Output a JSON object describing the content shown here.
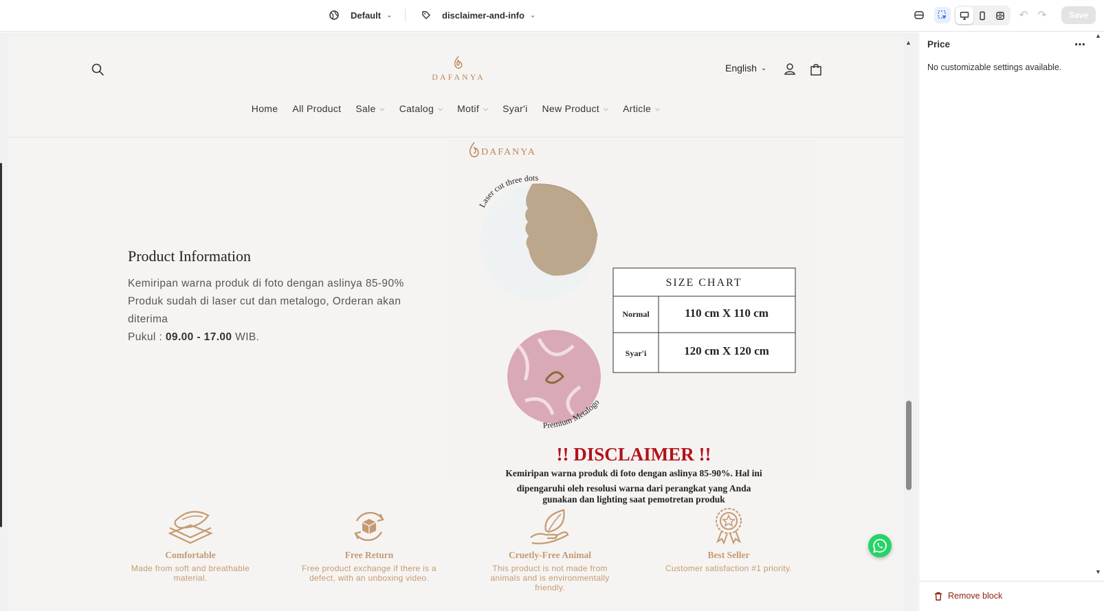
{
  "topbar": {
    "theme_label": "Default",
    "template_label": "disclaimer-and-info",
    "save_label": "Save"
  },
  "store": {
    "logo_text": "DAFANYA",
    "language": "English",
    "nav": [
      "Home",
      "All Product",
      "Sale",
      "Catalog",
      "Motif",
      "Syar'i",
      "New Product",
      "Article"
    ]
  },
  "info": {
    "heading": "Product Information",
    "line1": "Kemiripan warna produk di foto dengan aslinya 85-90%",
    "line2": "Produk sudah di laser cut dan metalogo, Orderan akan diterima",
    "line3_prefix": "Pukul : ",
    "line3_bold": "09.00 - 17.00",
    "line3_suffix": " WIB."
  },
  "product_image": {
    "logo_text": "DAFANYA",
    "circle_top_label": "Laser cut three dots",
    "circle_bottom_label": "Premium Metalogo",
    "size_chart_title": "SIZE CHART",
    "rows": [
      {
        "name": "Normal",
        "size": "110 cm X 110 cm"
      },
      {
        "name": "Syar'i",
        "size": "120 cm X 120 cm"
      }
    ],
    "disclaimer_title": "!! DISCLAIMER !!",
    "disclaimer_line1": "Kemiripan warna produk di foto dengan aslinya 85-90%. Hal ini",
    "disclaimer_line2": "dipengaruhi oleh resolusi warna dari perangkat yang Anda",
    "disclaimer_line3": "gunakan dan lighting saat pemotretan produk"
  },
  "features": [
    {
      "title": "Comfortable",
      "desc": "Made from soft and breathable material.",
      "icon": "fabric-icon"
    },
    {
      "title": "Free Return",
      "desc": "Free product exchange if there is a defect, with an unboxing video.",
      "icon": "return-box-icon"
    },
    {
      "title": "Cruetly-Free Animal",
      "desc": "This product is not made from animals and is environmentally friendly.",
      "icon": "leaf-hand-icon"
    },
    {
      "title": "Best Seller",
      "desc": "Customer satisfaction #1 priority.",
      "icon": "award-badge-icon"
    }
  ],
  "panel": {
    "title": "Price",
    "message": "No customizable settings available.",
    "remove_label": "Remove block"
  },
  "colors": {
    "brand_gold": "#c49a72",
    "disclaimer_red": "#b3121a",
    "canvas_bg": "#f6f4f2"
  }
}
